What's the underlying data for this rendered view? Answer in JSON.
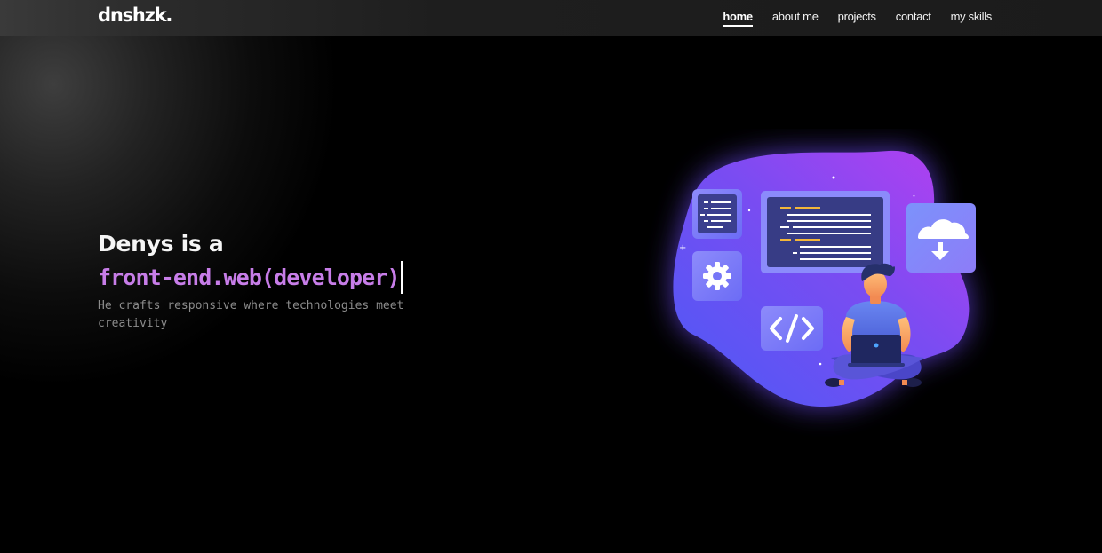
{
  "brand": {
    "logo_text": "dnshzk."
  },
  "nav": {
    "items": [
      {
        "label": "home",
        "active": true
      },
      {
        "label": "about me",
        "active": false
      },
      {
        "label": "projects",
        "active": false
      },
      {
        "label": "contact",
        "active": false
      },
      {
        "label": "my skills",
        "active": false
      }
    ]
  },
  "hero": {
    "intro": "Denys is a",
    "role": "front-end.web(developer)",
    "description": "He crafts responsive where technologies meet creativity"
  },
  "illustration": {
    "icons": [
      "code-editor-icon",
      "document-list-icon",
      "gear-icon",
      "code-brackets-icon",
      "cloud-download-icon",
      "developer-with-laptop"
    ]
  },
  "colors": {
    "accent": "#c77de8",
    "blob_start": "#5b5cf6",
    "blob_end": "#b43ef0",
    "background": "#000000",
    "navbar": "#1e1e1e"
  }
}
